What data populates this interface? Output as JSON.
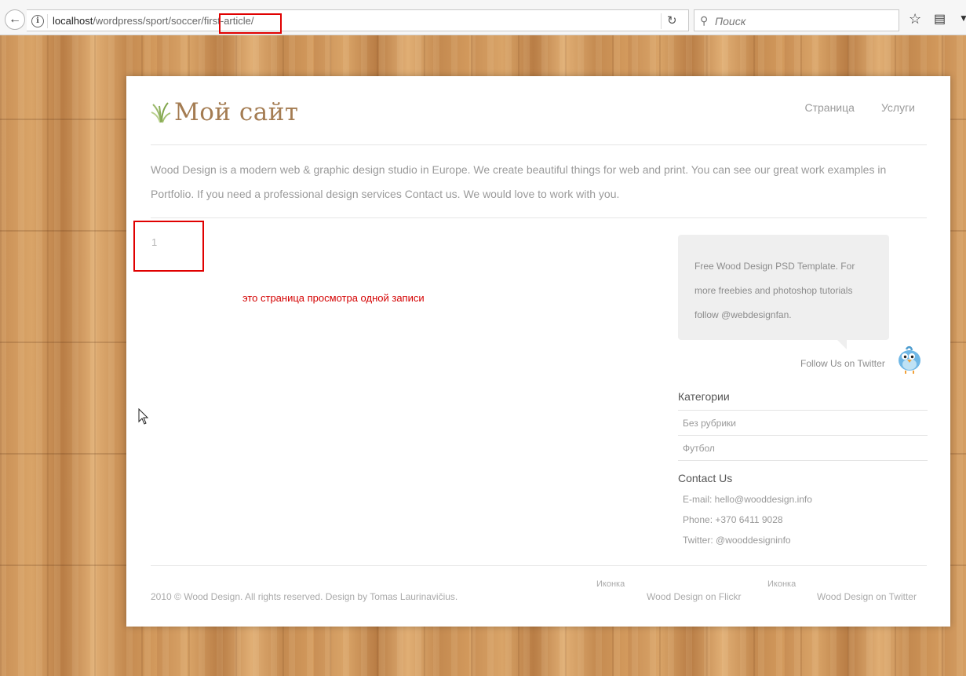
{
  "browser": {
    "url_host": "localhost",
    "url_path": "/wordpress/sport/soccer/",
    "url_slug": "first-article/",
    "search_placeholder": "Поиск"
  },
  "site": {
    "logo_text": "Мой сайт",
    "nav": [
      "Страница",
      "Услуги"
    ],
    "intro": "Wood Design is a modern web & graphic design studio in Europe. We create beautiful things for web and print. You can see our great work examples in Portfolio. If you need a professional design services Contact us. We would love to work with you."
  },
  "post": {
    "number": "1",
    "note": "это страница просмотра одной записи"
  },
  "sidebar": {
    "tweet_lines": [
      "Free Wood Design PSD Template. For",
      "more freebies and photoshop tutorials",
      "follow @webdesignfan."
    ],
    "follow_label": "Follow Us on Twitter",
    "categories_heading": "Категории",
    "categories": [
      "Без рубрики",
      "Футбол"
    ],
    "contact_heading": "Contact Us",
    "contact": {
      "email": "E-mail: hello@wooddesign.info",
      "phone": "Phone: +370 6411 9028",
      "twitter": "Twitter: @wooddesigninfo"
    }
  },
  "footer": {
    "copyright": "2010 © Wood Design. All rights reserved. Design by Tomas Laurinavičius.",
    "flickr_alt": "Иконка",
    "flickr_label": "Wood Design on Flickr",
    "twitter_alt": "Иконка",
    "twitter_label": "Wood Design on Twitter"
  },
  "colors": {
    "logo": "#a47c52",
    "annotation_red": "#e00000",
    "note_red": "#d40000"
  }
}
